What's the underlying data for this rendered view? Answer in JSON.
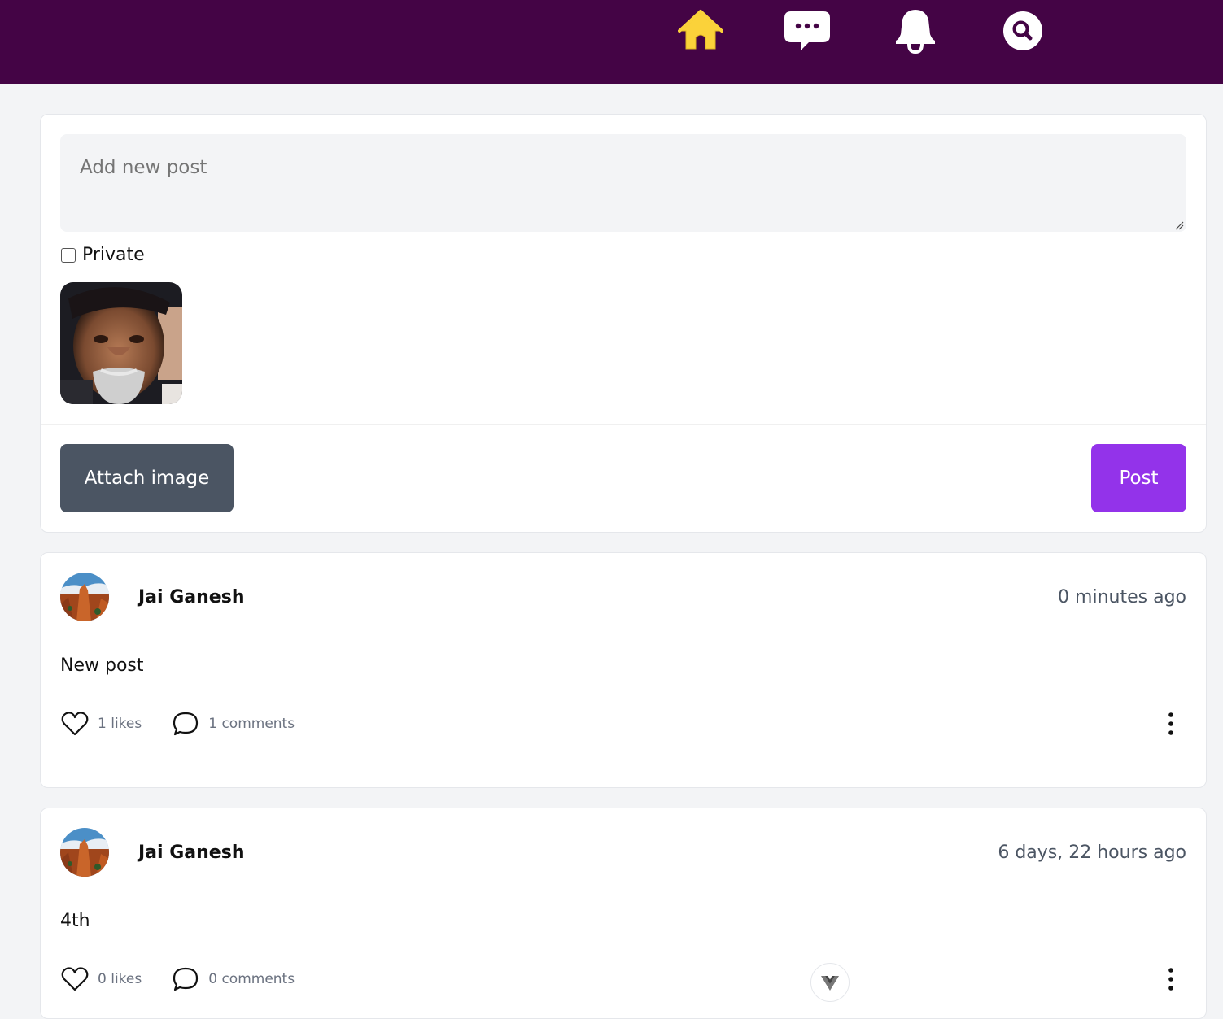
{
  "nav": {
    "icons": [
      "home-icon",
      "chat-icon",
      "bell-icon",
      "search-icon"
    ],
    "active_color": "#fbd23a",
    "bar_color": "#440445"
  },
  "composer": {
    "placeholder": "Add new post",
    "private_label": "Private",
    "private_checked": false,
    "attach_label": "Attach image",
    "post_label": "Post"
  },
  "posts": [
    {
      "author": "Jai Ganesh",
      "time": "0 minutes ago",
      "text": "New post",
      "likes": "1 likes",
      "comments": "1 comments"
    },
    {
      "author": "Jai Ganesh",
      "time": "6 days, 22 hours ago",
      "text": "4th",
      "likes": "0 likes",
      "comments": "0 comments"
    }
  ],
  "colors": {
    "post_button": "#9333ea",
    "attach_button": "#4b5563"
  }
}
